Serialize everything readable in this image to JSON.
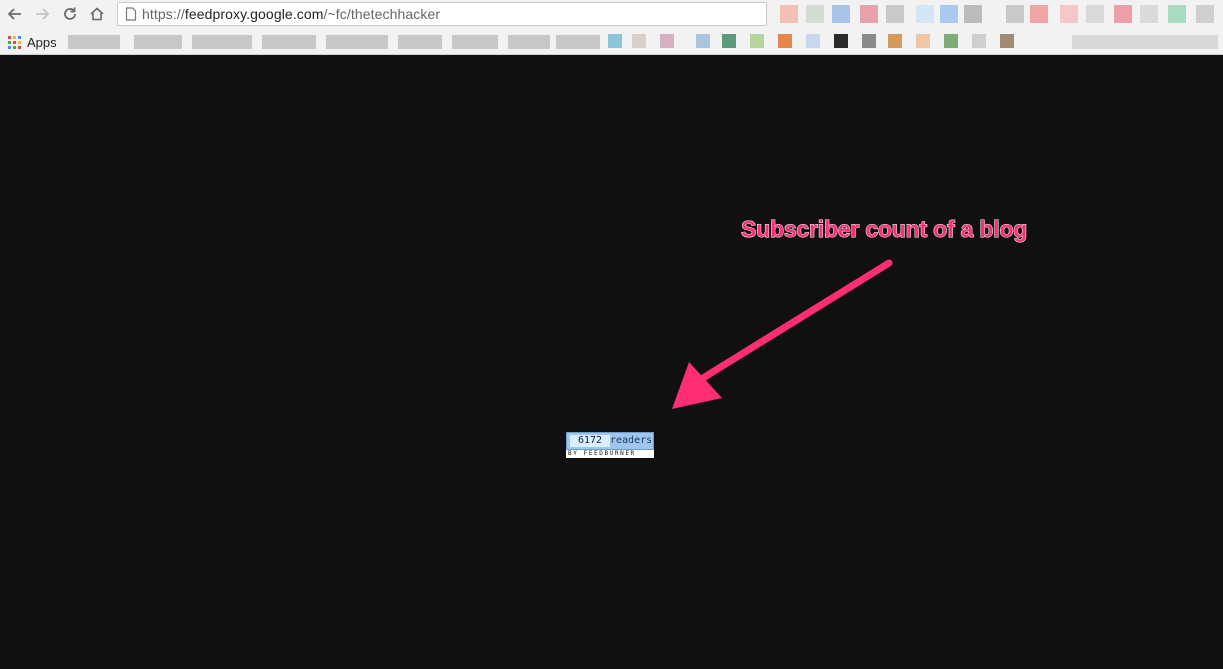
{
  "browser": {
    "url_prefix": "https://",
    "url_host": "feedproxy.google.com",
    "url_path": "/~fc/thetechhacker",
    "bookmarks_apps_label": "Apps"
  },
  "colors": {
    "annotation": "#ff2e72",
    "page_background": "#101010",
    "badge_blue": "#9fc7ee"
  },
  "annotation": {
    "text": "Subscriber count of a blog"
  },
  "feed_badge": {
    "count": "6172",
    "label": "readers",
    "footer": "BY FEEDBURNER"
  }
}
